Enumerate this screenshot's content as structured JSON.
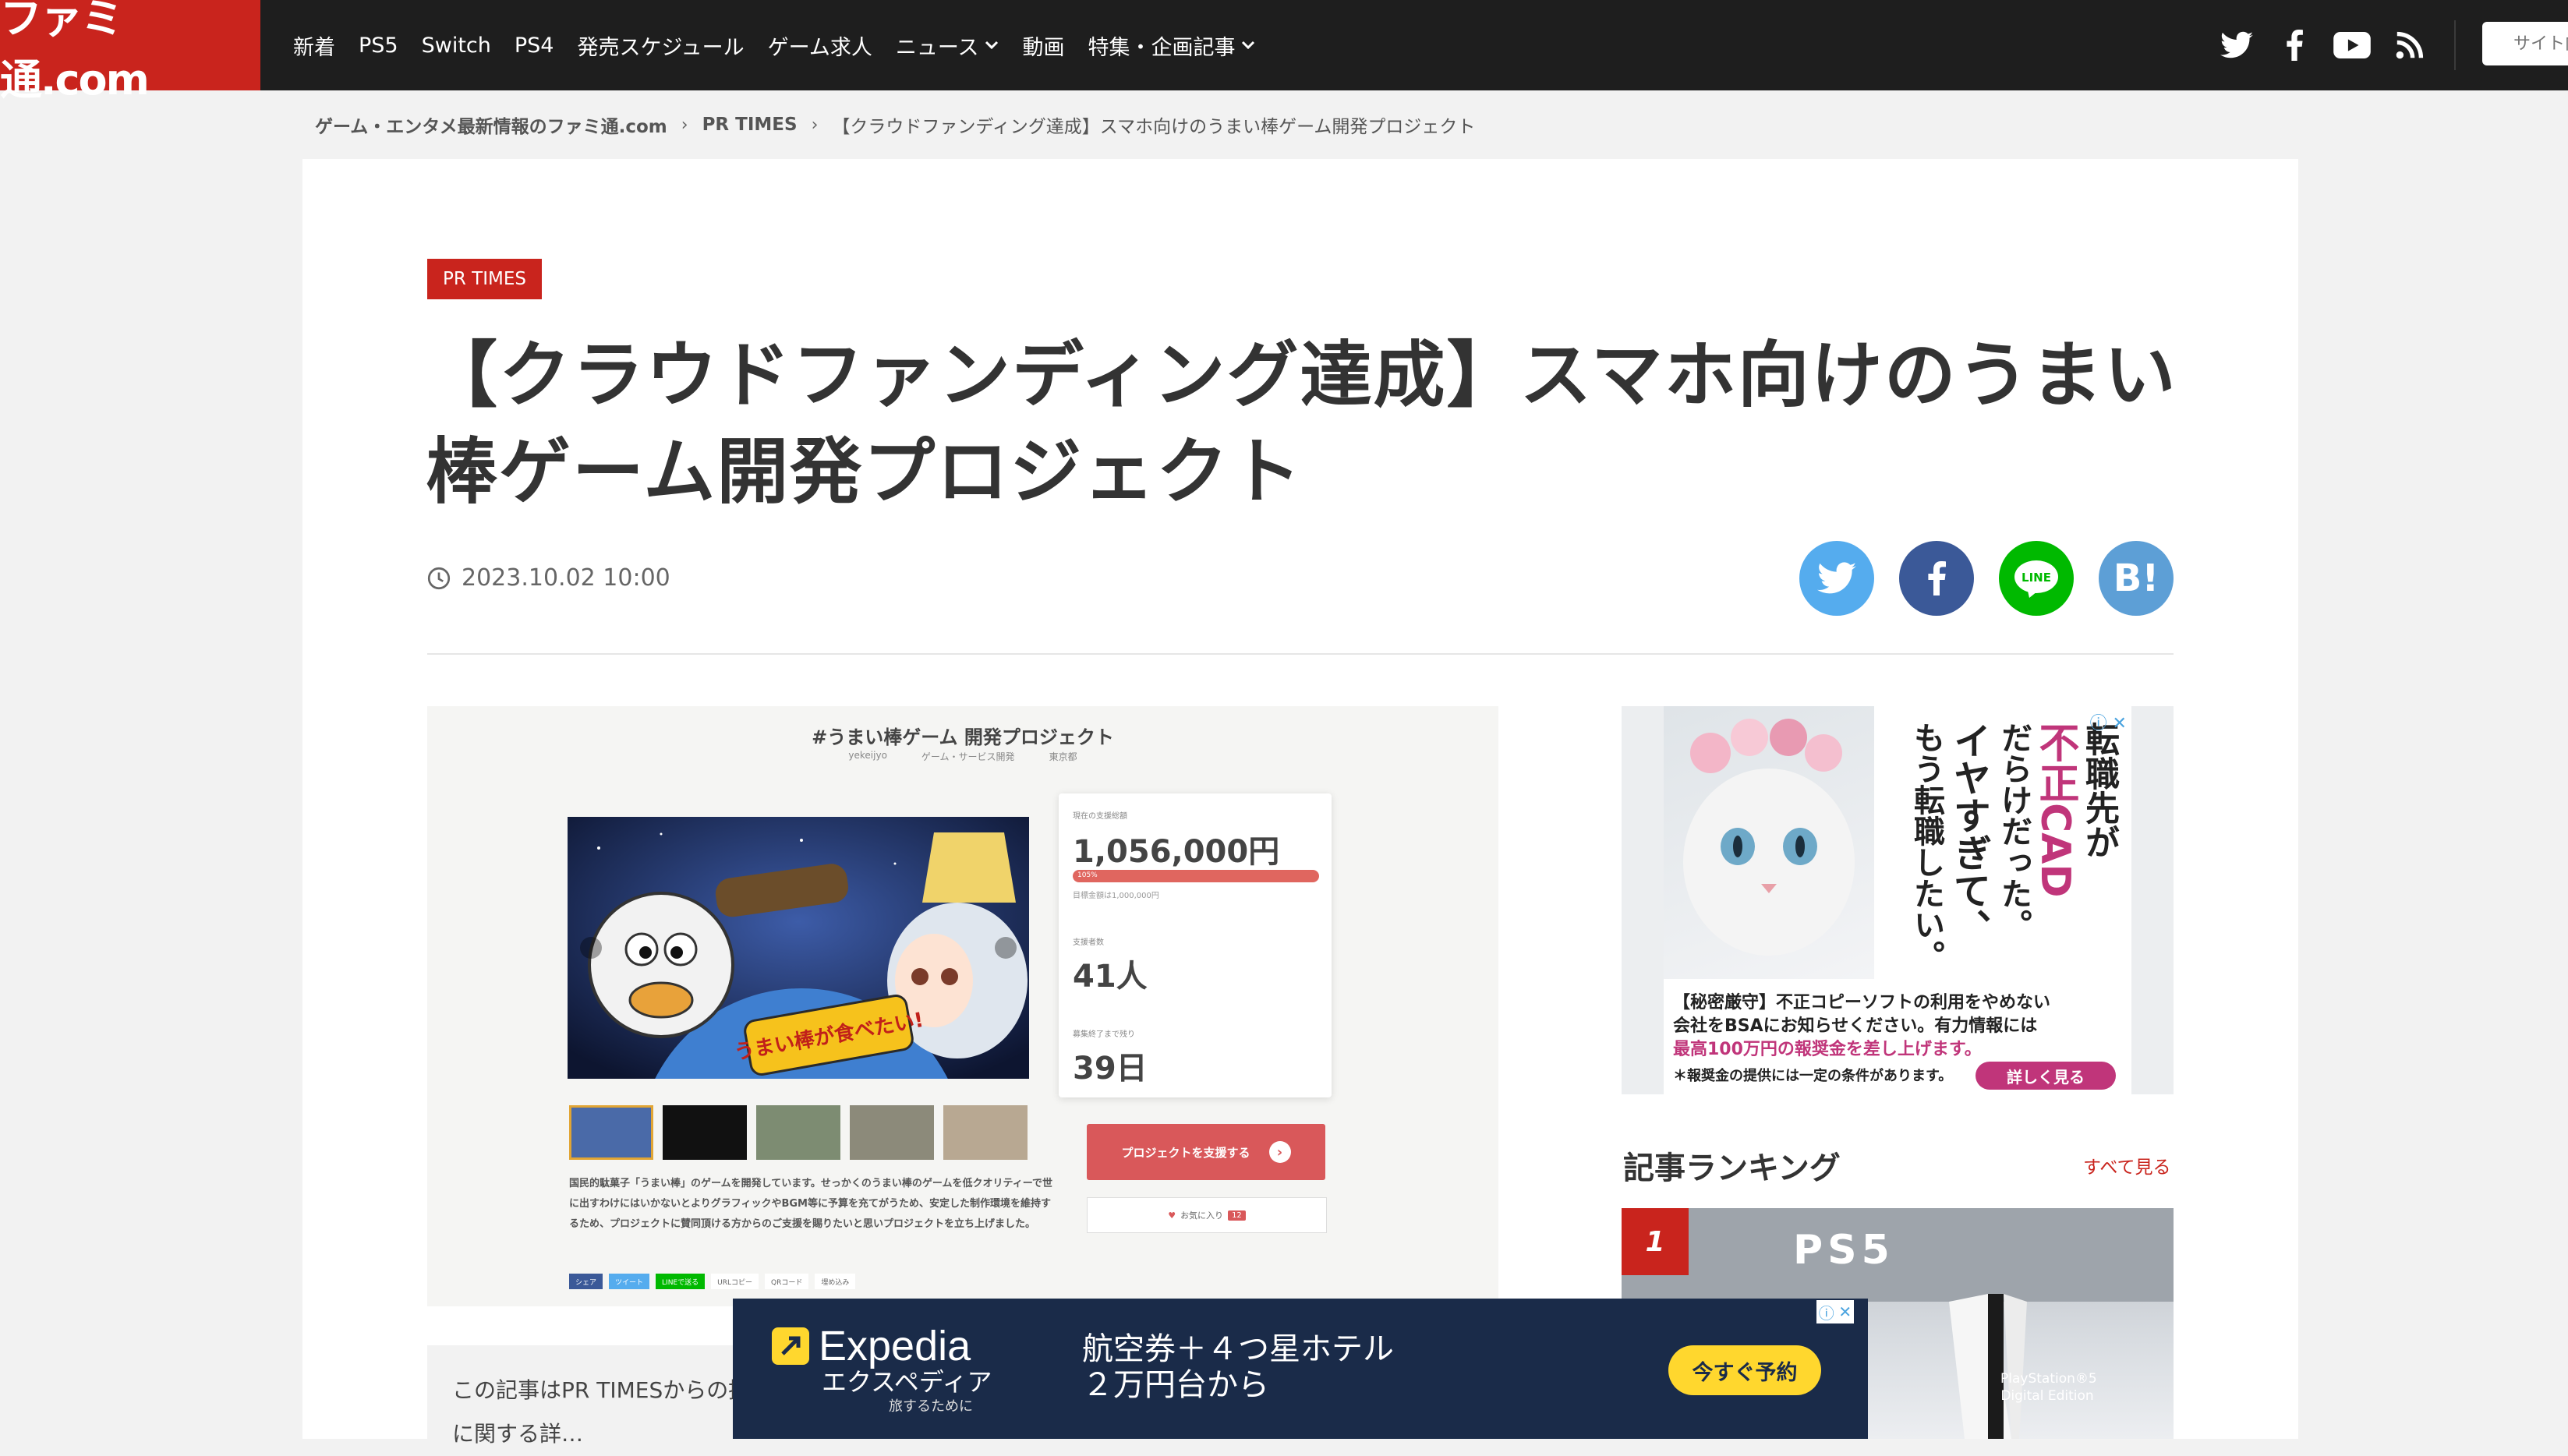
{
  "header": {
    "logo": "ファミ通.com",
    "nav": [
      "新着",
      "PS5",
      "Switch",
      "PS4",
      "発売スケジュール",
      "ゲーム求人",
      "ニュース",
      "動画",
      "特集・企画記事"
    ],
    "social_icons": [
      "twitter-icon",
      "facebook-icon",
      "youtube-icon",
      "rss-icon"
    ],
    "search_placeholder": "サイト内"
  },
  "breadcrumb": {
    "home": "ゲーム・エンタメ最新情報のファミ通.com",
    "category": "PR TIMES",
    "current": "【クラウドファンディング達成】スマホ向けのうまい棒ゲーム開発プロジェクト"
  },
  "article": {
    "tag": "PR TIMES",
    "title": "【クラウドファンディング達成】スマホ向けのうまい棒ゲーム開発プロジェクト",
    "date": "2023.10.02 10:00",
    "share_buttons": [
      "twitter",
      "facebook",
      "LINE",
      "B!"
    ],
    "note": "この記事はPR TIMESからの提供… る商品・サービスに関する詳…"
  },
  "project_image": {
    "title": "#うまい棒ゲーム 開発プロジェクト",
    "meta": [
      "yekeijyo",
      "ゲーム・サービス開発",
      "東京都"
    ],
    "amount_label": "現在の支援総額",
    "amount": "1,056,000円",
    "progress_label": "105%",
    "progress": 1.05,
    "goal": "目標金額は1,000,000円",
    "backers_label": "支援者数",
    "backers": "41人",
    "days_label": "募集終了まで残り",
    "days": "39日",
    "support_button": "プロジェクトを支援する",
    "favorite": "お気に入り",
    "favorite_count": "12",
    "description": "国民的駄菓子「うまい棒」のゲームを開発しています。せっかくのうまい棒のゲームを低クオリティーで世に出すわけにはいかないとよりグラフィックやBGM等に予算を充てがうため、安定した制作環境を維持するため、プロジェクトに賛同頂ける方からのご支援を賜りたいと思いプロジェクトを立ち上げました。",
    "share_chips": [
      "シェア",
      "ツイート",
      "LINEで送る",
      "URLコピー",
      "QRコード",
      "埋め込み"
    ],
    "logo_text": "うまい棒が食べたい!"
  },
  "sidebar": {
    "ad": {
      "vertical_lines": [
        "転職先が",
        "不正CAD",
        "だらけだった。",
        "イヤすぎて、",
        "もう転職したい。"
      ],
      "line1": "【秘密厳守】不正コピーソフトの利用をやめない",
      "line2": "会社をBSAにお知らせください。有力情報には",
      "line3": "最高100万円の報奨金を差し上げます。",
      "line4": "＊報奨金の提供には一定の条件があります。",
      "button": "詳しく見る"
    },
    "ranking": {
      "title": "記事ランキング",
      "see_all": "すべて見る",
      "rank": "1",
      "image_logo": "PS5",
      "image_caption": "PlayStation®5 Digital Edition"
    }
  },
  "bottom_ad": {
    "brand": "Expedia",
    "brand_kana": "エクスペディア",
    "tagline": "旅するために",
    "copy_line1": "航空券＋４つ星ホテル",
    "copy_line2": "２万円台から",
    "cta": "今すぐ予約"
  },
  "colors": {
    "brand_red": "#c9241d",
    "nav_bg": "#1e1e1e",
    "twitter": "#55acee",
    "facebook": "#3b5998",
    "line": "#00b900",
    "hatena": "#5d9fd6",
    "expedia_bg": "#1a2b49",
    "expedia_yellow": "#ffd72e"
  }
}
